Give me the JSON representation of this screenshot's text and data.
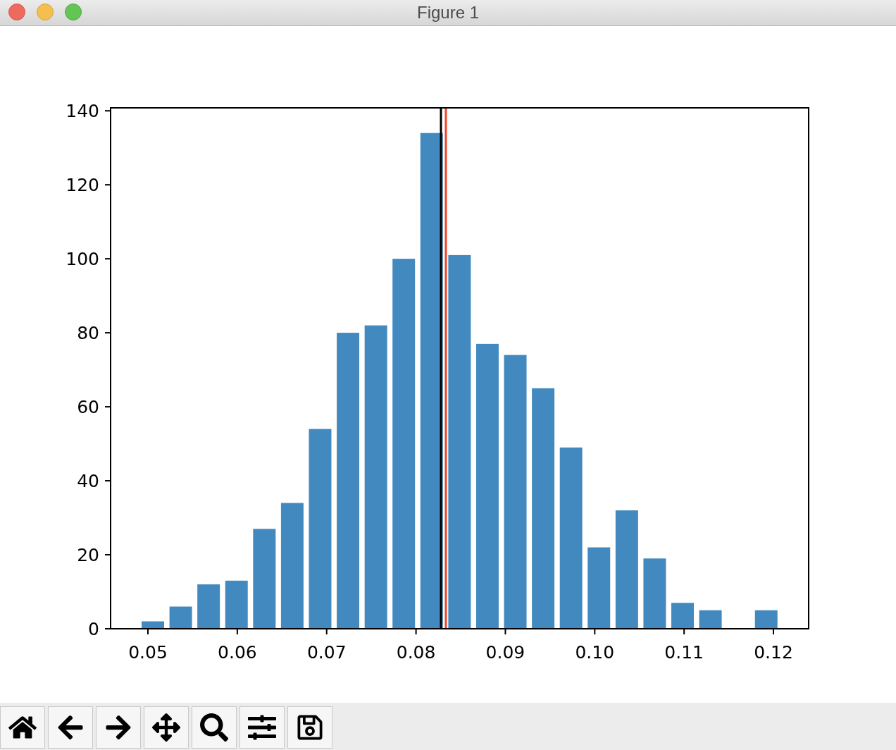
{
  "window": {
    "title": "Figure 1"
  },
  "figure": {
    "chart_data": {
      "type": "bar",
      "x": [
        0.05055,
        0.05367,
        0.05679,
        0.05991,
        0.06303,
        0.06615,
        0.06927,
        0.07239,
        0.07551,
        0.07863,
        0.08175,
        0.08487,
        0.08799,
        0.09111,
        0.09423,
        0.09735,
        0.10047,
        0.10359,
        0.10671,
        0.10983,
        0.11295,
        0.11919
      ],
      "series": [
        {
          "color": "#4289bf",
          "values": [
            2,
            6,
            12,
            13,
            27,
            34,
            54,
            80,
            82,
            100,
            134,
            101,
            77,
            74,
            65,
            49,
            22,
            32,
            19,
            7,
            5,
            5
          ]
        }
      ],
      "xlim": [
        0.04582,
        0.12394
      ],
      "ylim": [
        0,
        140.8
      ],
      "xticks": [
        {
          "value": 0.05,
          "label": "0.05"
        },
        {
          "value": 0.06,
          "label": "0.06"
        },
        {
          "value": 0.07,
          "label": "0.07"
        },
        {
          "value": 0.08,
          "label": "0.08"
        },
        {
          "value": 0.09,
          "label": "0.09"
        },
        {
          "value": 0.1,
          "label": "0.10"
        },
        {
          "value": 0.11,
          "label": "0.11"
        },
        {
          "value": 0.12,
          "label": "0.12"
        }
      ],
      "yticks": [
        0,
        20,
        40,
        60,
        80,
        100,
        120,
        140
      ],
      "ref_lines": [
        {
          "axis": "x",
          "value": 0.08279,
          "color": "#000000"
        },
        {
          "axis": "x",
          "value": 0.08334,
          "color": "#f0442a"
        }
      ]
    }
  },
  "toolbar": [
    {
      "kind": "home"
    },
    {
      "kind": "back"
    },
    {
      "kind": "forward"
    },
    {
      "kind": "pan"
    },
    {
      "kind": "zoom"
    },
    {
      "kind": "configure"
    },
    {
      "kind": "save"
    }
  ]
}
